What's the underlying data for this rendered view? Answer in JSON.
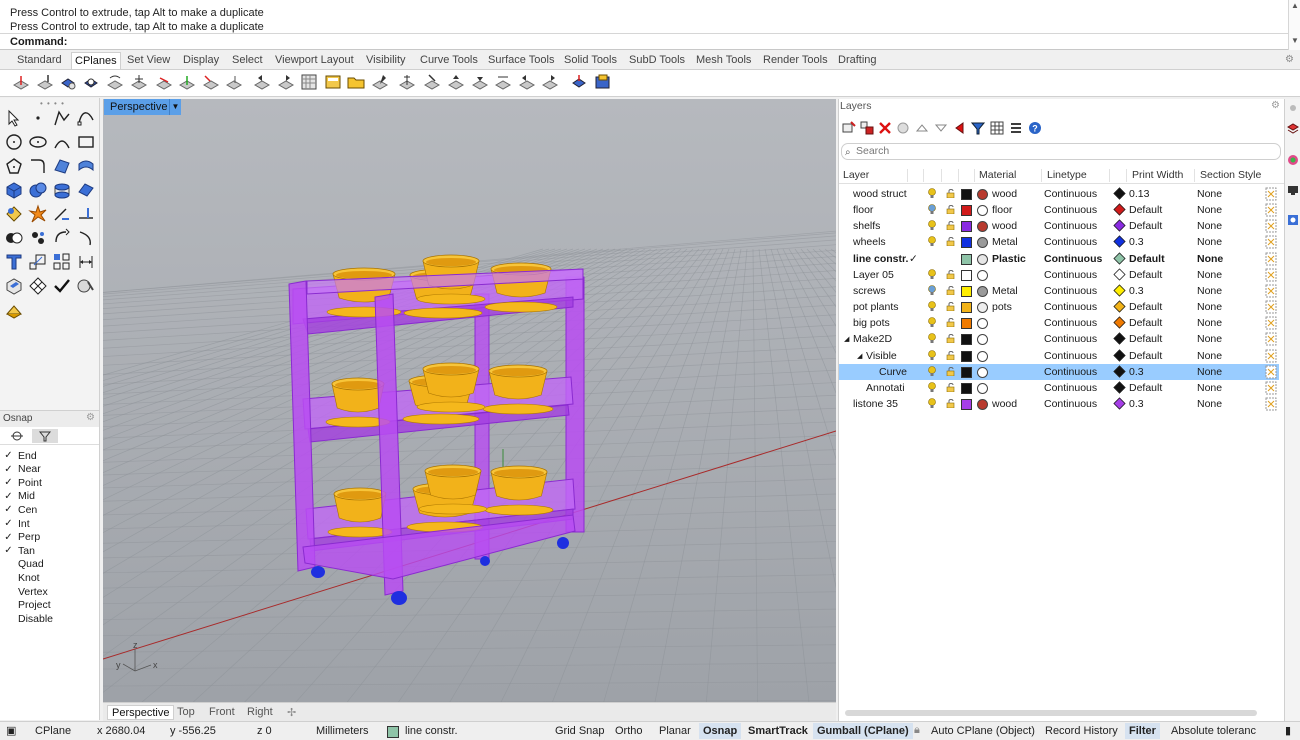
{
  "command": {
    "history": [
      "Press Control to extrude, tap Alt to make a duplicate",
      "Press Control to extrude, tap Alt to make a duplicate"
    ],
    "prompt": "Command:"
  },
  "tabs": [
    "Standard",
    "CPlanes",
    "Set View",
    "Display",
    "Select",
    "Viewport Layout",
    "Visibility",
    "Curve Tools",
    "Surface Tools",
    "Solid Tools",
    "SubD Tools",
    "Mesh Tools",
    "Render Tools",
    "Drafting"
  ],
  "active_tab": "CPlanes",
  "viewport": {
    "title": "Perspective",
    "axis_labels": {
      "x": "x",
      "y": "y",
      "z": "z"
    },
    "tabs": [
      "Perspective",
      "Top",
      "Front",
      "Right"
    ],
    "active_tab": "Perspective"
  },
  "osnap": {
    "title": "Osnap",
    "items": [
      {
        "label": "End",
        "checked": true
      },
      {
        "label": "Near",
        "checked": true
      },
      {
        "label": "Point",
        "checked": true
      },
      {
        "label": "Mid",
        "checked": true
      },
      {
        "label": "Cen",
        "checked": true
      },
      {
        "label": "Int",
        "checked": true
      },
      {
        "label": "Perp",
        "checked": true
      },
      {
        "label": "Tan",
        "checked": true
      },
      {
        "label": "Quad",
        "checked": false
      },
      {
        "label": "Knot",
        "checked": false
      },
      {
        "label": "Vertex",
        "checked": false
      },
      {
        "label": "Project",
        "checked": false
      },
      {
        "label": "Disable",
        "checked": false
      }
    ]
  },
  "layers": {
    "title": "Layers",
    "search_placeholder": "Search",
    "columns": [
      "Layer",
      "Material",
      "Linetype",
      "Print Width",
      "Section Style"
    ],
    "rows": [
      {
        "name": "wood struct",
        "indent": 0,
        "expander": "",
        "current": false,
        "bulb_color": "#e8c21a",
        "color": "#111111",
        "material": "wood",
        "mat_fill": "#b83a2e",
        "linetype": "Continuous",
        "pw_color": "#111111",
        "print_width": "0.13",
        "section": "None",
        "bold": false,
        "selected": false
      },
      {
        "name": "floor",
        "indent": 0,
        "expander": "",
        "current": false,
        "bulb_color": "#6a9fd6",
        "color": "#d11a1a",
        "material": "floor",
        "mat_fill": "#ffffff",
        "linetype": "Continuous",
        "pw_color": "#d11a1a",
        "print_width": "Default",
        "section": "None",
        "bold": false,
        "selected": false
      },
      {
        "name": "shelfs",
        "indent": 0,
        "expander": "",
        "current": false,
        "bulb_color": "#e8c21a",
        "color": "#8a2be2",
        "material": "wood",
        "mat_fill": "#b83a2e",
        "linetype": "Continuous",
        "pw_color": "#8a2be2",
        "print_width": "Default",
        "section": "None",
        "bold": false,
        "selected": false
      },
      {
        "name": "wheels",
        "indent": 0,
        "expander": "",
        "current": false,
        "bulb_color": "#e8c21a",
        "color": "#1030e0",
        "material": "Metal",
        "mat_fill": "#9a9a9a",
        "linetype": "Continuous",
        "pw_color": "#1030e0",
        "print_width": "0.3",
        "section": "None",
        "bold": false,
        "selected": false
      },
      {
        "name": "line constr.",
        "indent": 0,
        "expander": "",
        "current": true,
        "current_mark": "✓",
        "bulb_color": "",
        "color": "#8fc4a8",
        "material": "Plastic",
        "mat_fill": "#e6e6e6",
        "linetype": "Continuous",
        "pw_color": "#8fc4a8",
        "print_width": "Default",
        "section": "None",
        "bold": true,
        "selected": false
      },
      {
        "name": "Layer 05",
        "indent": 0,
        "expander": "",
        "current": false,
        "bulb_color": "#e8c21a",
        "color": "#ffffff",
        "material": "",
        "mat_fill": "#ffffff",
        "linetype": "Continuous",
        "pw_color": "#ffffff",
        "print_width": "Default",
        "section": "None",
        "bold": false,
        "selected": false
      },
      {
        "name": "screws",
        "indent": 0,
        "expander": "",
        "current": false,
        "bulb_color": "#6a9fd6",
        "color": "#ffee00",
        "material": "Metal",
        "mat_fill": "#9a9a9a",
        "linetype": "Continuous",
        "pw_color": "#ffee00",
        "print_width": "0.3",
        "section": "None",
        "bold": false,
        "selected": false
      },
      {
        "name": "pot plants",
        "indent": 0,
        "expander": "",
        "current": false,
        "bulb_color": "#e8c21a",
        "color": "#f2b318",
        "material": "pots",
        "mat_fill": "#eeeeee",
        "linetype": "Continuous",
        "pw_color": "#f2b318",
        "print_width": "Default",
        "section": "None",
        "bold": false,
        "selected": false
      },
      {
        "name": "big pots",
        "indent": 0,
        "expander": "",
        "current": false,
        "bulb_color": "#e8c21a",
        "color": "#f07a00",
        "material": "",
        "mat_fill": "#ffffff",
        "linetype": "Continuous",
        "pw_color": "#f07a00",
        "print_width": "Default",
        "section": "None",
        "bold": false,
        "selected": false
      },
      {
        "name": "Make2D",
        "indent": 0,
        "expander": "◢",
        "current": false,
        "bulb_color": "#e8c21a",
        "color": "#111111",
        "material": "",
        "mat_fill": "#ffffff",
        "linetype": "Continuous",
        "pw_color": "#111111",
        "print_width": "Default",
        "section": "None",
        "bold": false,
        "selected": false
      },
      {
        "name": "Visible",
        "indent": 1,
        "expander": "◢",
        "current": false,
        "bulb_color": "#e8c21a",
        "color": "#111111",
        "material": "",
        "mat_fill": "#ffffff",
        "linetype": "Continuous",
        "pw_color": "#111111",
        "print_width": "Default",
        "section": "None",
        "bold": false,
        "selected": false
      },
      {
        "name": "Curve",
        "indent": 2,
        "expander": "",
        "current": false,
        "bulb_color": "#e8c21a",
        "color": "#111111",
        "material": "",
        "mat_fill": "#ffffff",
        "linetype": "Continuous",
        "pw_color": "#111111",
        "print_width": "0.3",
        "section": "None",
        "bold": false,
        "selected": true
      },
      {
        "name": "Annotati",
        "indent": 1,
        "expander": "",
        "current": false,
        "bulb_color": "#e8c21a",
        "color": "#111111",
        "material": "",
        "mat_fill": "#ffffff",
        "linetype": "Continuous",
        "pw_color": "#111111",
        "print_width": "Default",
        "section": "None",
        "bold": false,
        "selected": false
      },
      {
        "name": "listone 35",
        "indent": 0,
        "expander": "",
        "current": false,
        "bulb_color": "#e8c21a",
        "color": "#a63ee8",
        "material": "wood",
        "mat_fill": "#b83a2e",
        "linetype": "Continuous",
        "pw_color": "#a63ee8",
        "print_width": "0.3",
        "section": "None",
        "bold": false,
        "selected": false
      }
    ]
  },
  "status": {
    "cplane": "CPlane",
    "x": "x 2680.04",
    "y": "y -556.25",
    "z": "z 0",
    "units": "Millimeters",
    "layer": "line constr.",
    "layer_color": "#8fc4a8",
    "grid_snap": "Grid Snap",
    "ortho": "Ortho",
    "planar": "Planar",
    "osnap": "Osnap",
    "smarttrack": "SmartTrack",
    "gumball": "Gumball (CPlane)",
    "auto_cplane": "Auto CPlane (Object)",
    "record_history": "Record History",
    "filter": "Filter",
    "tolerance": "Absolute toleranc"
  },
  "colors": {
    "viewport_bg": "#a5a9af",
    "shelf_purple": "#b84cf2",
    "pot_yellow": "#f5b81c",
    "wheel_blue": "#1f2fe0",
    "active_blue": "#5b9fe8",
    "selection": "#99ccff"
  }
}
